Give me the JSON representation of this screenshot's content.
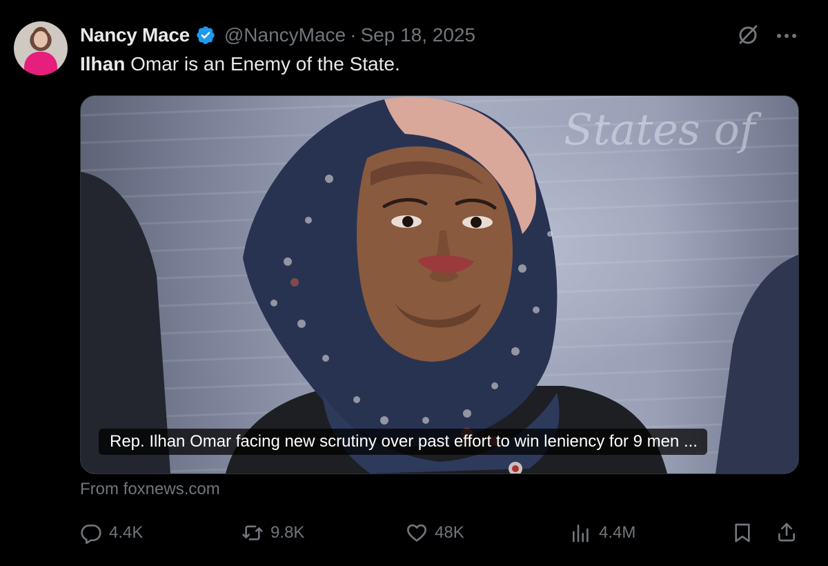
{
  "post": {
    "author_name": "Nancy Mace",
    "verified_icon": "verified-badge-icon",
    "handle": "@NancyMace",
    "separator": "·",
    "date": "Sep 18, 2025",
    "text_bold": "Ilhan",
    "text_rest": " Omar is an Enemy of the State."
  },
  "media": {
    "caption": "Rep. Ilhan Omar facing new scrutiny over past effort to win leniency for 9 men ...",
    "source": "From foxnews.com"
  },
  "actions": {
    "replies": "4.4K",
    "reposts": "9.8K",
    "likes": "48K",
    "views": "4.4M"
  },
  "colors": {
    "background": "#000000",
    "text_primary": "#e7e9ea",
    "text_secondary": "#71767b",
    "verified": "#1d9bf0"
  },
  "icons": [
    "grok-icon",
    "more-icon",
    "reply-icon",
    "repost-icon",
    "like-icon",
    "views-icon",
    "bookmark-icon",
    "share-icon"
  ]
}
